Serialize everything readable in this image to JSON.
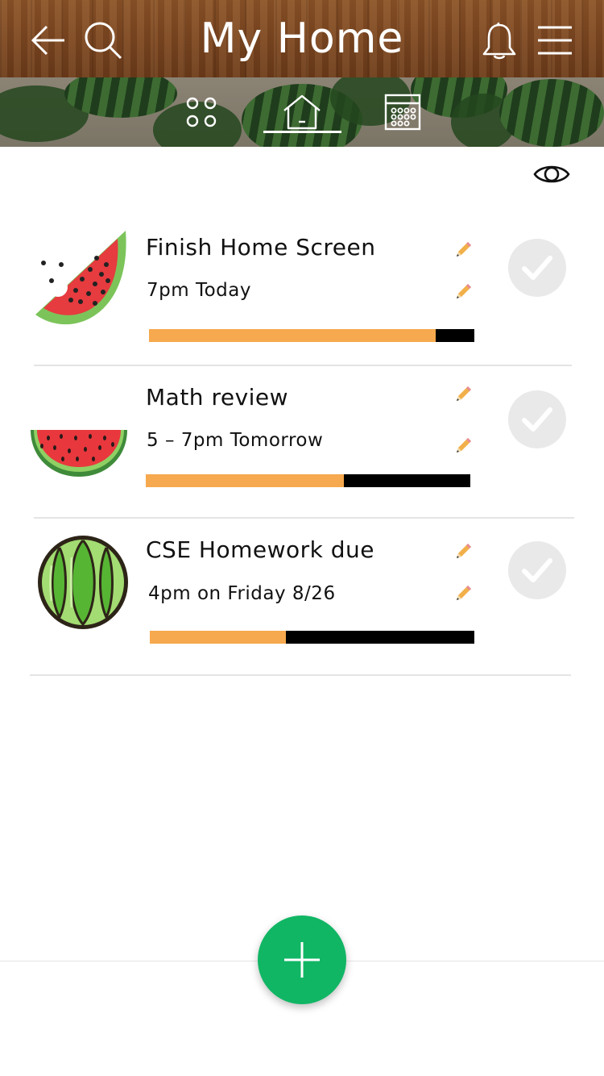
{
  "header": {
    "title": "My Home",
    "back_icon": "back-arrow-icon",
    "search_icon": "search-icon",
    "notification_icon": "bell-icon",
    "menu_icon": "hamburger-menu-icon"
  },
  "nav": {
    "tabs": [
      {
        "id": "grid",
        "icon": "grid-dots-icon",
        "active": false
      },
      {
        "id": "home",
        "icon": "home-icon",
        "active": true
      },
      {
        "id": "calendar",
        "icon": "calendar-icon",
        "active": false
      }
    ]
  },
  "visibility_icon": "eye-icon",
  "tasks": [
    {
      "title": "Finish Home Screen",
      "time": "7pm Today",
      "progress": 0.88,
      "image": "watermelon-slice-bitten",
      "completed": false
    },
    {
      "title": "Math review",
      "time": "5 – 7pm Tomorrow",
      "progress": 0.61,
      "image": "watermelon-half",
      "completed": false
    },
    {
      "title": "CSE Homework due",
      "time": "4pm on Friday 8/26",
      "progress": 0.42,
      "image": "whole-watermelon",
      "completed": false
    }
  ],
  "add_button_icon": "plus-icon",
  "colors": {
    "header_wood": "#7a4520",
    "progress_fill": "#f6a94e",
    "progress_track": "#000000",
    "fab_green": "#10b664",
    "check_circle": "#e9e9e9"
  }
}
